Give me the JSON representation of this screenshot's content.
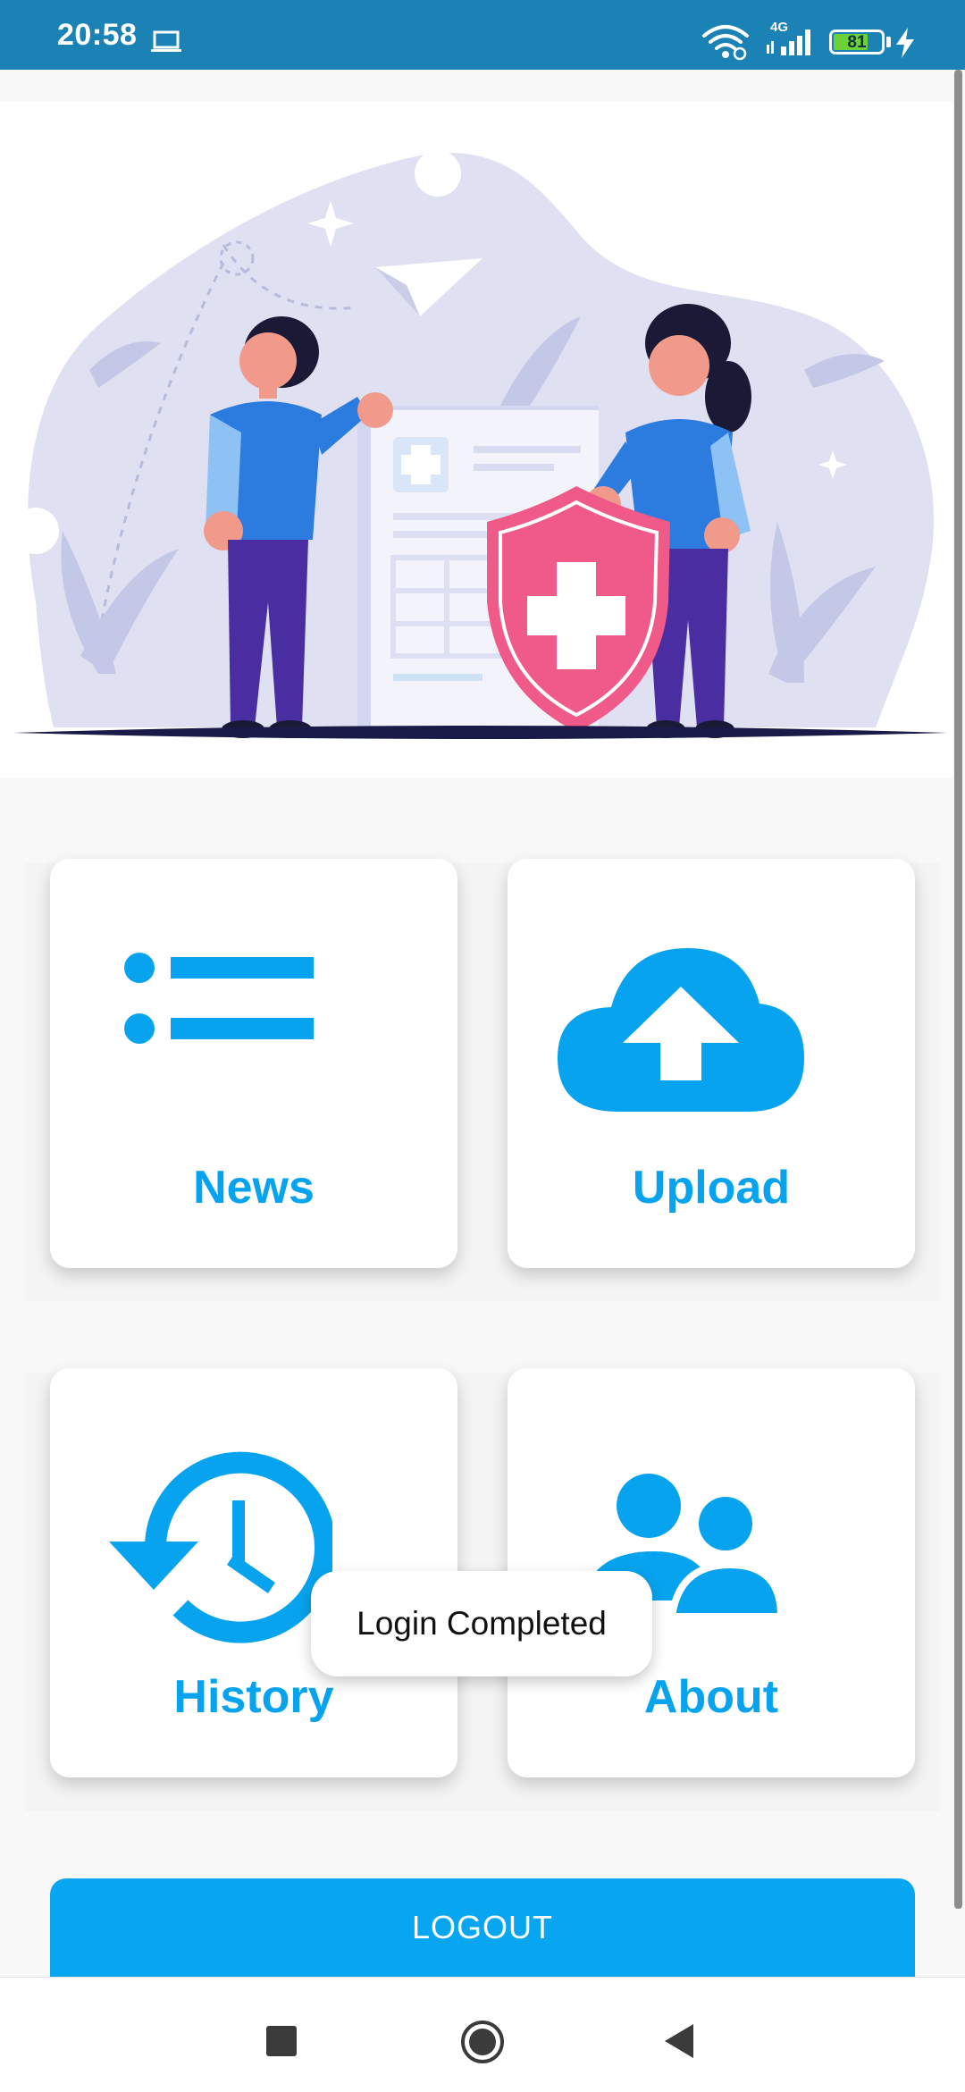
{
  "status_bar": {
    "time": "20:58",
    "network": "4G",
    "battery": "81",
    "icons": [
      "laptop-icon",
      "wifi-icon",
      "signal-icon",
      "battery-icon",
      "charging-bolt-icon"
    ]
  },
  "hero": {
    "illustration": "health-insurance-illustration"
  },
  "menu": {
    "news": {
      "label": "News",
      "icon": "list-icon"
    },
    "upload": {
      "label": "Upload",
      "icon": "cloud-upload-icon"
    },
    "history": {
      "label": "History",
      "icon": "history-icon"
    },
    "about": {
      "label": "About",
      "icon": "people-icon"
    }
  },
  "toast": {
    "message": "Login Completed"
  },
  "logout": {
    "label": "LOGOUT"
  },
  "nav": {
    "icons": [
      "recents-icon",
      "home-icon",
      "back-icon"
    ]
  },
  "colors": {
    "status_bar": "#1b82b6",
    "accent": "#08a3ee",
    "button": "#08a6f0",
    "background": "#f8f8f8"
  }
}
